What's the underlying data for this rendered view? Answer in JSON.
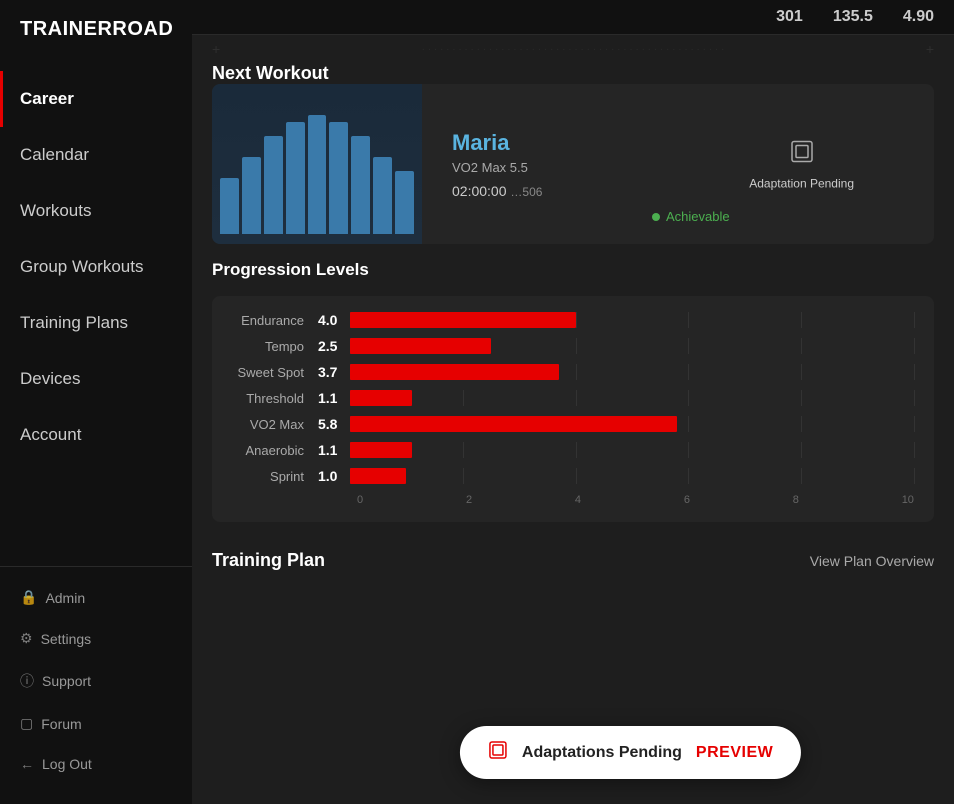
{
  "app": {
    "name": "TRAINERROAD"
  },
  "topbar": {
    "stat1": "301",
    "stat2": "135.5",
    "stat3": "4.90"
  },
  "sidebar": {
    "nav_items": [
      {
        "id": "career",
        "label": "Career",
        "active": true
      },
      {
        "id": "calendar",
        "label": "Calendar",
        "active": false
      },
      {
        "id": "workouts",
        "label": "Workouts",
        "active": false
      },
      {
        "id": "group-workouts",
        "label": "Group Workouts",
        "active": false
      },
      {
        "id": "training-plans",
        "label": "Training Plans",
        "active": false
      },
      {
        "id": "devices",
        "label": "Devices",
        "active": false
      },
      {
        "id": "account",
        "label": "Account",
        "active": false
      }
    ],
    "bottom_items": [
      {
        "id": "admin",
        "label": "Admin",
        "icon": "🔒"
      },
      {
        "id": "settings",
        "label": "Settings",
        "icon": "⚙"
      },
      {
        "id": "support",
        "label": "Support",
        "icon": "ⓘ"
      },
      {
        "id": "forum",
        "label": "Forum",
        "icon": "□"
      },
      {
        "id": "logout",
        "label": "Log Out",
        "icon": "←"
      }
    ]
  },
  "next_workout": {
    "section_title": "Next Workout",
    "name": "Maria",
    "type": "VO2 Max 5.5",
    "duration": "02:00:00",
    "sub_info": "…506",
    "adaptation_label": "Adaptation Pending",
    "achievable_label": "Achievable"
  },
  "progression_levels": {
    "title": "Progression Levels",
    "max_value": 10,
    "x_axis": [
      "0",
      "2",
      "4",
      "6",
      "8",
      "10"
    ],
    "items": [
      {
        "label": "Endurance",
        "value": 4.0,
        "display": "4.0",
        "bar_pct": 40
      },
      {
        "label": "Tempo",
        "value": 2.5,
        "display": "2.5",
        "bar_pct": 25
      },
      {
        "label": "Sweet Spot",
        "value": 3.7,
        "display": "3.7",
        "bar_pct": 37
      },
      {
        "label": "Threshold",
        "value": 1.1,
        "display": "1.1",
        "bar_pct": 11
      },
      {
        "label": "VO2 Max",
        "value": 5.8,
        "display": "5.8",
        "bar_pct": 58
      },
      {
        "label": "Anaerobic",
        "value": 1.1,
        "display": "1.1",
        "bar_pct": 11
      },
      {
        "label": "Sprint",
        "value": 1.0,
        "display": "1.0",
        "bar_pct": 10
      }
    ]
  },
  "adaptations_banner": {
    "text": "Adaptations Pending",
    "preview_label": "PREVIEW"
  },
  "training_plan": {
    "title": "Training Plan",
    "view_link": "View Plan Overview"
  }
}
